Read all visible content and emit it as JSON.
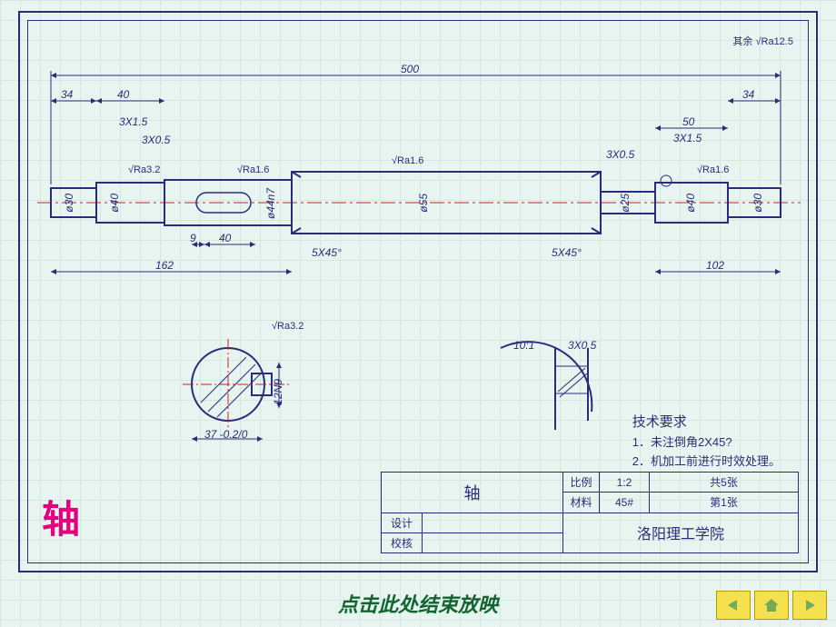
{
  "slideshow_hint": "点击此处结束放映",
  "big_label": "轴",
  "surface_default": "其余 √Ra12.5",
  "dimensions": {
    "len_500": "500",
    "len_162": "162",
    "len_102": "102",
    "len_50": "50",
    "len_40_left": "40",
    "len_34_left": "34",
    "len_34_right": "34",
    "chamfer_3x15_left": "3X1.5",
    "chamfer_3x15_right": "3X1.5",
    "chamfer_3x05_left": "3X0.5",
    "chamfer_3x05_right": "3X0.5",
    "chamfer_5x45_left": "5X45°",
    "chamfer_5x45_right": "5X45°",
    "key_9": "9",
    "key_40": "40",
    "dia_30_l": "ø30",
    "dia_40_l": "ø40",
    "dia_44n7": "ø44n7",
    "dia_55": "ø55",
    "dia_25": "ø25",
    "dia_40_r": "ø40",
    "dia_30_r": "ø30",
    "section_37": "37 -0.2/0",
    "section_12n9": "12N9",
    "detail_10_1": "10:1",
    "detail_3x05": "3X0.5",
    "ra32": "√Ra3.2",
    "ra16_left": "√Ra1.6",
    "ra16_mid": "√Ra1.6",
    "ra16_right": "√Ra1.6",
    "ra32_sec": "√Ra3.2"
  },
  "tech_req": {
    "title": "技术要求",
    "line1": "1．未注倒角2X45?",
    "line2": "2．机加工前进行时效处理。"
  },
  "title_block": {
    "part_name": "轴",
    "scale_label": "比例",
    "scale_value": "1:2",
    "pages_total": "共5张",
    "material_label": "材料",
    "material_value": "45#",
    "page_no": "第1张",
    "designer_label": "设计",
    "checker_label": "校核",
    "school": "洛阳理工学院"
  }
}
